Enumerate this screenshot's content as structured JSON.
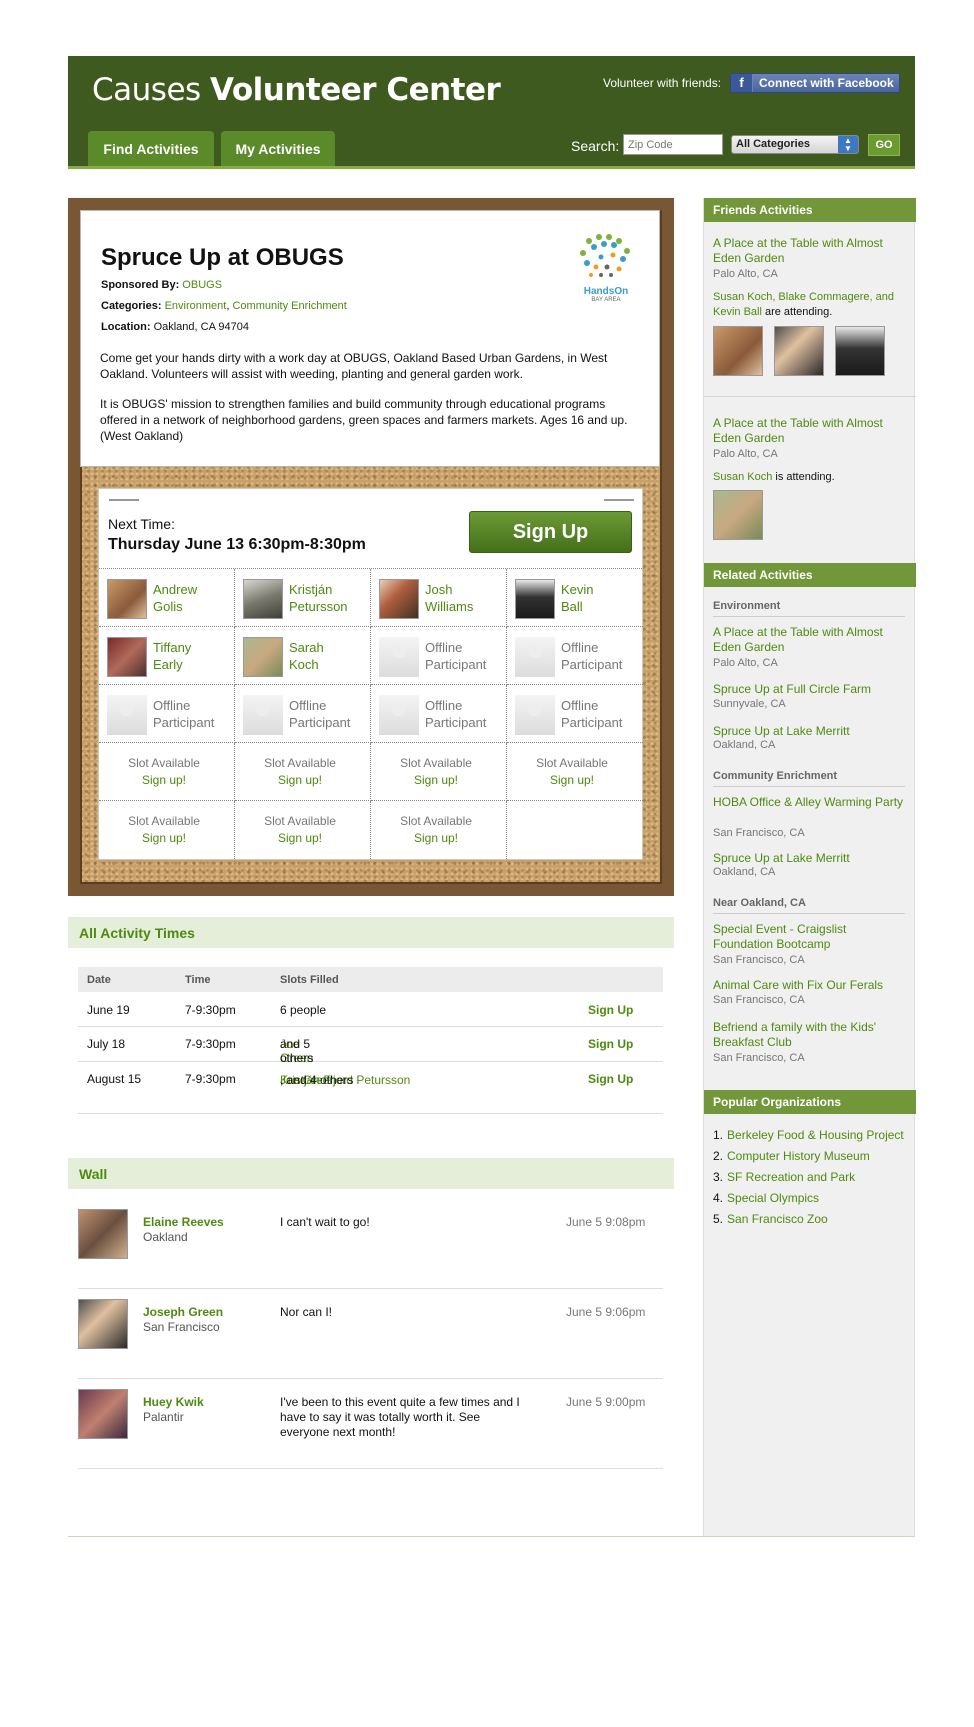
{
  "header": {
    "logo_light": "Causes",
    "logo_bold": "Volunteer Center",
    "volunteer_with_friends": "Volunteer with friends:",
    "fb_glyph": "f",
    "connect_facebook": "Connect with Facebook",
    "tabs": [
      {
        "label": "Find Activities"
      },
      {
        "label": "My Activities"
      }
    ],
    "search_label": "Search:",
    "zip_placeholder": "Zip Code",
    "category_value": "All Categories",
    "go_label": "GO"
  },
  "event": {
    "title": "Spruce Up at OBUGS",
    "sponsored_label": "Sponsored By:",
    "sponsor": "OBUGS",
    "categories_label": "Categories:",
    "categories": [
      "Environment",
      "Community Enrichment"
    ],
    "location_label": "Location:",
    "location": "Oakland, CA 94704",
    "desc1": "Come get your hands dirty with a work day at OBUGS, Oakland Based Urban Gardens, in West Oakland. Volunteers will assist with weeding, planting and general garden work.",
    "desc2": "It is OBUGS' mission to strengthen families and build community through educational programs offered in a network of neighborhood gardens, green spaces and farmers markets. Ages 16 and up. (West Oakland)",
    "partner_logo": "HandsOn",
    "partner_sub": "BAY AREA"
  },
  "signup": {
    "next_label": "Next Time:",
    "next_time": "Thursday June 13 6:30pm-8:30pm",
    "button": "Sign Up",
    "participants": [
      {
        "line1": "Andrew",
        "line2": "Golis"
      },
      {
        "line1": "Kristján",
        "line2": "Petursson"
      },
      {
        "line1": "Josh",
        "line2": "Williams"
      },
      {
        "line1": "Kevin",
        "line2": "Ball"
      },
      {
        "line1": "Tiffany",
        "line2": "Early"
      },
      {
        "line1": "Sarah",
        "line2": "Koch"
      },
      {
        "line1": "Offline",
        "line2": "Participant"
      },
      {
        "line1": "Offline",
        "line2": "Participant"
      },
      {
        "line1": "Offline",
        "line2": "Participant"
      },
      {
        "line1": "Offline",
        "line2": "Participant"
      },
      {
        "line1": "Offline",
        "line2": "Participant"
      },
      {
        "line1": "Offline",
        "line2": "Participant"
      }
    ],
    "slot_text": "Slot Available",
    "slot_link": "Sign up!"
  },
  "times": {
    "heading": "All Activity Times",
    "columns": [
      "Date",
      "Time",
      "Slots Filled"
    ],
    "rows": [
      {
        "date": "June 19",
        "time": "7-9:30pm",
        "filled": "6 people",
        "action": "Sign Up"
      },
      {
        "date": "July 18",
        "time": "7-9:30pm",
        "link1": "Joe Green",
        "rest": " and 5 others",
        "action": "Sign Up"
      },
      {
        "date": "August 15",
        "time": "7-9:30pm",
        "link1": "Joe Green",
        "sep": ", ",
        "link2": "Kristján F'jord Petursson",
        "rest": ", and 4 others",
        "action": "Sign Up"
      }
    ]
  },
  "wall": {
    "heading": "Wall",
    "posts": [
      {
        "name": "Elaine Reeves",
        "location": "Oakland",
        "message": "I can't wait to go!",
        "time": "June 5 9:08pm"
      },
      {
        "name": "Joseph Green",
        "location": "San Francisco",
        "message": "Nor can I!",
        "time": "June 5 9:06pm"
      },
      {
        "name": "Huey Kwik",
        "location": "Palantir",
        "message": "I've been to this event quite a few times and I have to say it was totally worth it. See everyone next month!",
        "time": "June 5 9:00pm"
      }
    ]
  },
  "sidebar": {
    "friends_heading": "Friends Activities",
    "friend_activities": [
      {
        "title": "A Place at the Table with Almost Eden Garden",
        "location": "Palo Alto, CA",
        "names": "Susan Koch, Blake Commagere, and Kevin Ball",
        "suffix": " are attending."
      },
      {
        "title": "A Place at the Table with Almost Eden Garden",
        "location": "Palo Alto, CA",
        "names": "Susan Koch",
        "suffix": " is attending."
      }
    ],
    "related_heading": "Related Activities",
    "related": [
      {
        "category": "Environment",
        "items": [
          {
            "title": "A Place at the Table with Almost Eden Garden",
            "location": "Palo Alto, CA"
          },
          {
            "title": "Spruce Up at Full Circle Farm",
            "location": "Sunnyvale, CA"
          },
          {
            "title": "Spruce Up at Lake Merritt",
            "location": "Oakland, CA"
          }
        ]
      },
      {
        "category": "Community Enrichment",
        "items": [
          {
            "title": "HOBA Office & Alley Warming Party",
            "location": "San Francisco, CA"
          },
          {
            "title": "Spruce Up at Lake Merritt",
            "location": "Oakland, CA"
          }
        ]
      },
      {
        "category": "Near Oakland, CA",
        "items": [
          {
            "title": "Special Event - Craigslist Foundation Bootcamp",
            "location": "San Francisco, CA"
          },
          {
            "title": "Animal Care with Fix Our Ferals",
            "location": "San Francisco, CA"
          },
          {
            "title": "Befriend a family with the Kids' Breakfast Club",
            "location": "San Francisco, CA"
          }
        ]
      }
    ],
    "popular_heading": "Popular Organizations",
    "organizations": [
      {
        "num": "1.",
        "name": "Berkeley Food & Housing Project"
      },
      {
        "num": "2.",
        "name": "Computer History Museum"
      },
      {
        "num": "3.",
        "name": "SF Recreation and Park"
      },
      {
        "num": "4.",
        "name": "Special Olympics"
      },
      {
        "num": "5.",
        "name": "San Francisco Zoo"
      }
    ]
  }
}
